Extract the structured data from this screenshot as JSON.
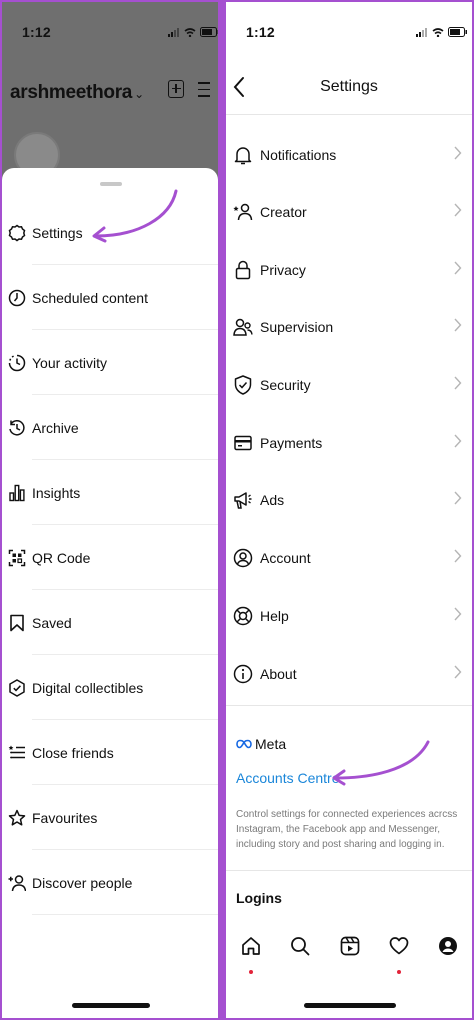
{
  "left": {
    "status_time": "1:12",
    "username": "arshmeethora",
    "menu_items": [
      {
        "label": "Settings",
        "icon": "settings-gear-icon"
      },
      {
        "label": "Scheduled content",
        "icon": "clock-icon"
      },
      {
        "label": "Your activity",
        "icon": "activity-icon"
      },
      {
        "label": "Archive",
        "icon": "archive-icon"
      },
      {
        "label": "Insights",
        "icon": "insights-bar-chart-icon"
      },
      {
        "label": "QR Code",
        "icon": "qr-code-icon"
      },
      {
        "label": "Saved",
        "icon": "bookmark-icon"
      },
      {
        "label": "Digital collectibles",
        "icon": "collectibles-shield-icon"
      },
      {
        "label": "Close friends",
        "icon": "close-friends-list-icon"
      },
      {
        "label": "Favourites",
        "icon": "star-icon"
      },
      {
        "label": "Discover people",
        "icon": "add-person-icon"
      }
    ]
  },
  "right": {
    "status_time": "1:12",
    "title": "Settings",
    "items": [
      {
        "label": "Notifications",
        "icon": "bell-icon"
      },
      {
        "label": "Creator",
        "icon": "creator-icon"
      },
      {
        "label": "Privacy",
        "icon": "lock-icon"
      },
      {
        "label": "Supervision",
        "icon": "supervision-icon"
      },
      {
        "label": "Security",
        "icon": "shield-check-icon"
      },
      {
        "label": "Payments",
        "icon": "card-icon"
      },
      {
        "label": "Ads",
        "icon": "megaphone-icon"
      },
      {
        "label": "Account",
        "icon": "account-circle-icon"
      },
      {
        "label": "Help",
        "icon": "lifebuoy-icon"
      },
      {
        "label": "About",
        "icon": "info-icon"
      }
    ],
    "meta_label": "Meta",
    "accounts_centre": "Accounts Centre",
    "description": "Control settings for connected experiences acrcss Instagram, the Facebook app and Messenger, including story and post sharing and logging in.",
    "logins_heading": "Logins"
  },
  "colors": {
    "accent_link": "#1a86d9",
    "annotation_arrow": "#a550d0",
    "notification_dot": "#e2233a"
  }
}
